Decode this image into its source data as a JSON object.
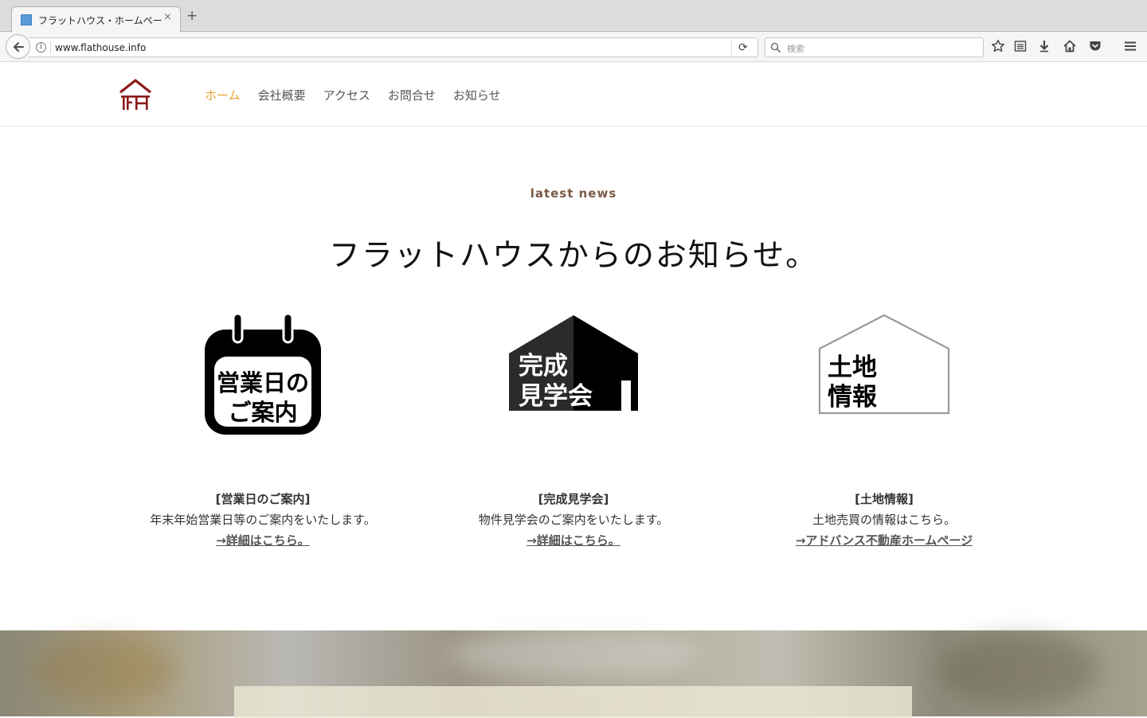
{
  "browser": {
    "tab_title": "フラットハウス・ホームペー...",
    "tab_close": "×",
    "new_tab": "+",
    "url": "www.flathouse.info",
    "search_placeholder": "検索"
  },
  "site": {
    "logo_alt": "FH",
    "nav": [
      {
        "label": "ホーム",
        "active": true
      },
      {
        "label": "会社概要",
        "active": false
      },
      {
        "label": "アクセス",
        "active": false
      },
      {
        "label": "お問合せ",
        "active": false
      },
      {
        "label": "お知らせ",
        "active": false
      }
    ]
  },
  "news": {
    "eyebrow": "latest news",
    "headline": "フラットハウスからのお知らせ。",
    "cards": [
      {
        "icon": "calendar-icon",
        "icon_text": [
          "営業日の",
          "ご案内"
        ],
        "title": "[営業日のご案内]",
        "desc": "年末年始営業日等のご案内をいたします。",
        "link": "→詳細はこちら。"
      },
      {
        "icon": "open-house-icon",
        "icon_text": [
          "完成",
          "見学会"
        ],
        "title": "[完成見学会]",
        "desc": "物件見学会のご案内をいたします。",
        "link": "→詳細はこちら。"
      },
      {
        "icon": "land-info-icon",
        "icon_text": [
          "土地",
          "情報"
        ],
        "title": "[土地情報]",
        "desc": "土地売買の情報はこちら。",
        "link": "→アドバンス不動産ホームページ"
      }
    ]
  },
  "colors": {
    "accent": "#e8a634",
    "eyebrow": "#7a5a45",
    "logo": "#8b1a1a"
  }
}
